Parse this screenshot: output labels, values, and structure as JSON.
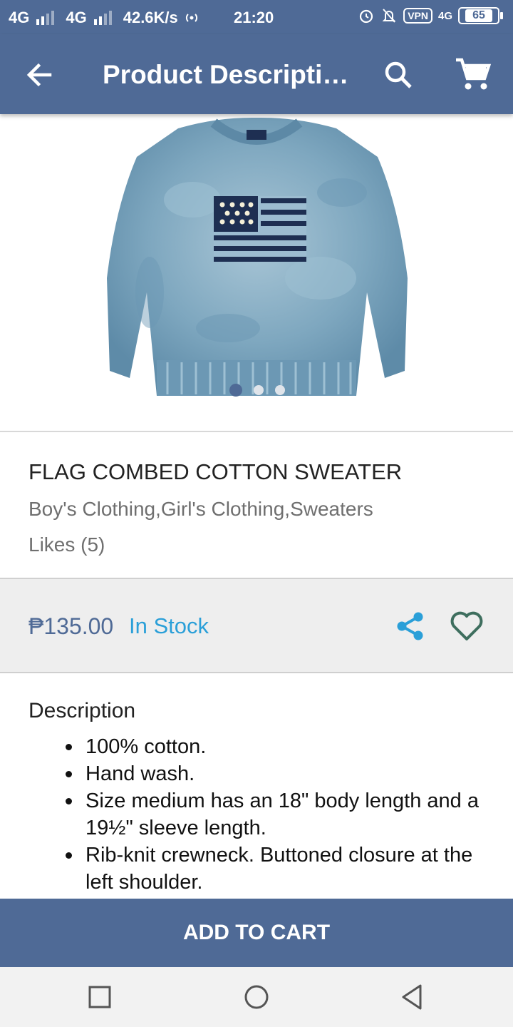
{
  "status_bar": {
    "network1": "4G",
    "network2": "4G",
    "speed": "42.6K/s",
    "time": "21:20",
    "vpn": "VPN",
    "network3": "4G",
    "battery": "65"
  },
  "app_bar": {
    "title": "Product Description",
    "icons": [
      "back-arrow-icon",
      "search-icon",
      "cart-icon"
    ]
  },
  "gallery": {
    "image": "sweater-photo",
    "page_count": 3,
    "active_page": 1
  },
  "product": {
    "name": "FLAG COMBED COTTON SWEATER",
    "categories": "Boy's Clothing,Girl's Clothing,Sweaters",
    "likes": "Likes (5)"
  },
  "pricing": {
    "price": "₱135.00",
    "stock": "In Stock",
    "price_color": "#4f6a96",
    "stock_color": "#2a9fd8"
  },
  "description": {
    "heading": "Description",
    "items": [
      "100% cotton.",
      "Hand wash.",
      "Size medium has an 18\" body length and a 19½\" sleeve length.",
      "Rib-knit crewneck. Buttoned closure at the left shoulder."
    ]
  },
  "actions": {
    "add_to_cart": "ADD TO CART"
  },
  "theme": {
    "primary": "#4f6a96",
    "accent": "#2a9fd8"
  }
}
